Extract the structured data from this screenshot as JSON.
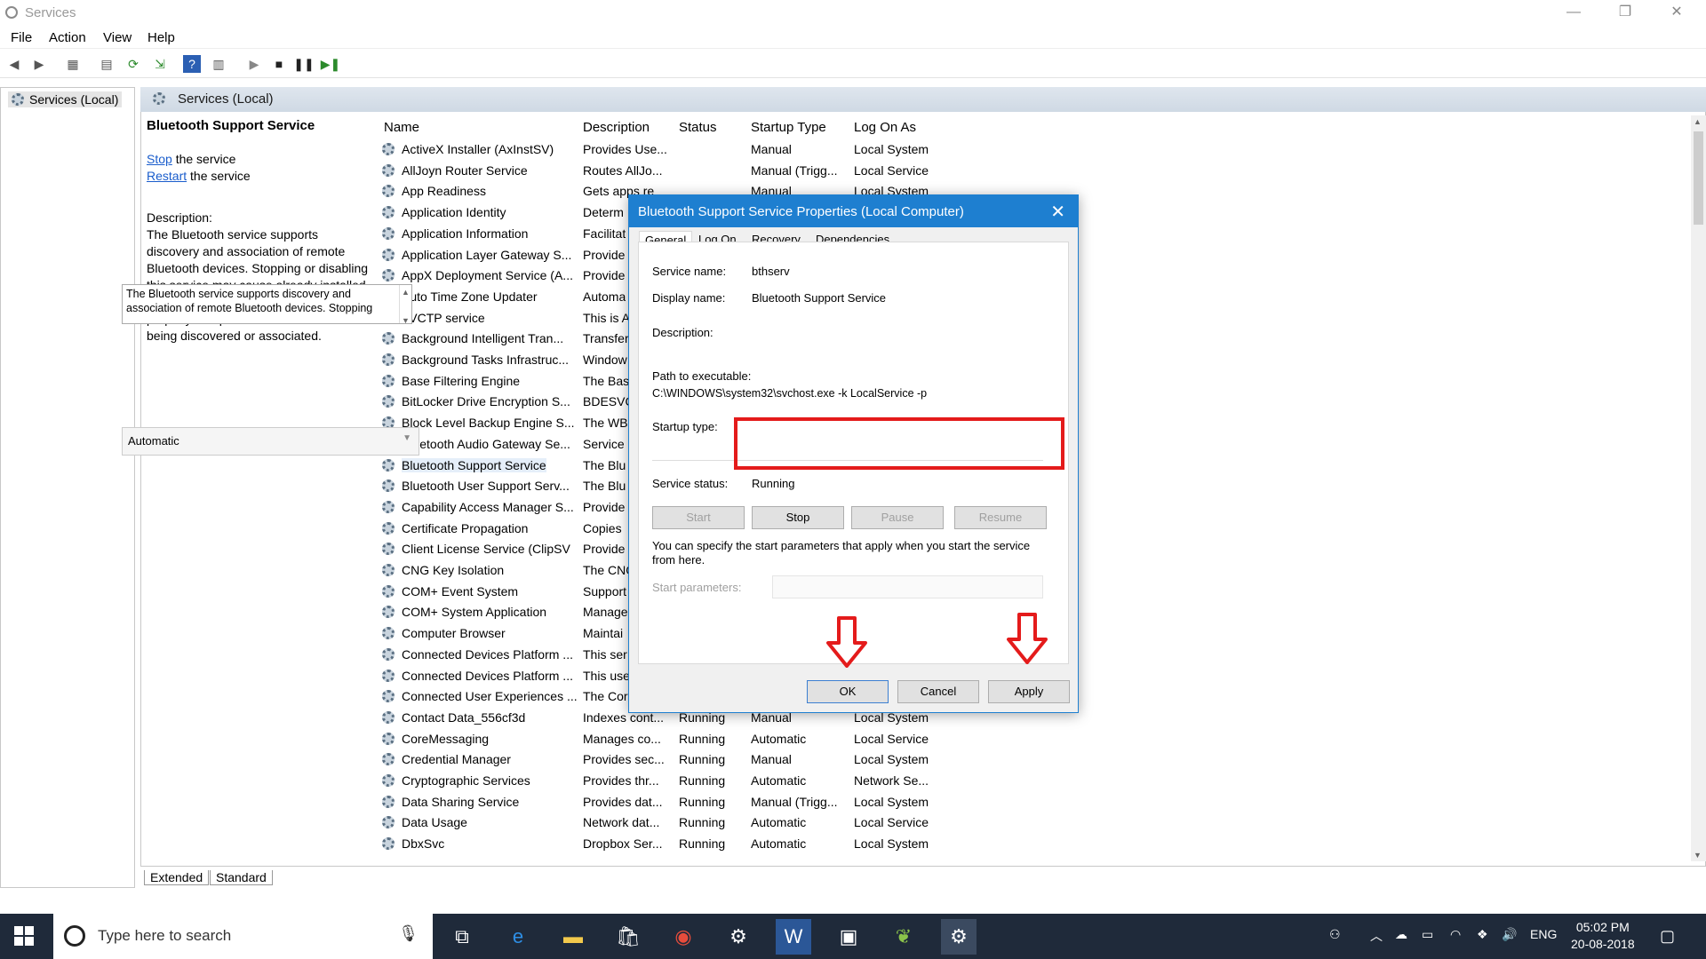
{
  "window": {
    "title": "Services",
    "minimize": "—",
    "maximize": "❐",
    "close": "✕"
  },
  "menu": [
    "File",
    "Action",
    "View",
    "Help"
  ],
  "tree": {
    "root": "Services (Local)"
  },
  "header": {
    "title": "Services (Local)"
  },
  "details": {
    "service_name": "Bluetooth Support Service",
    "stop_link": "Stop",
    "stop_suffix": " the service",
    "restart_link": "Restart",
    "restart_suffix": " the service",
    "description_label": "Description:",
    "description": "The Bluetooth service supports discovery and association of remote Bluetooth devices.  Stopping or disabling this service may cause already installed Bluetooth devices to fail to operate properly and prevent new devices from being discovered or associated."
  },
  "columns": [
    "Name",
    "Description",
    "Status",
    "Startup Type",
    "Log On As"
  ],
  "services": [
    {
      "name": "ActiveX Installer (AxInstSV)",
      "desc": "Provides Use...",
      "status": "",
      "startup": "Manual",
      "logon": "Local System"
    },
    {
      "name": "AllJoyn Router Service",
      "desc": "Routes AllJo...",
      "status": "",
      "startup": "Manual (Trigg...",
      "logon": "Local Service"
    },
    {
      "name": "App Readiness",
      "desc": "Gets apps re",
      "status": "",
      "startup": "Manual",
      "logon": "Local System"
    },
    {
      "name": "Application Identity",
      "desc": "Determ",
      "status": "",
      "startup": "",
      "logon": ""
    },
    {
      "name": "Application Information",
      "desc": "Facilitat",
      "status": "",
      "startup": "",
      "logon": ""
    },
    {
      "name": "Application Layer Gateway S...",
      "desc": "Provide",
      "status": "",
      "startup": "",
      "logon": ""
    },
    {
      "name": "AppX Deployment Service (A...",
      "desc": "Provide",
      "status": "",
      "startup": "",
      "logon": ""
    },
    {
      "name": "Auto Time Zone Updater",
      "desc": "Automa",
      "status": "",
      "startup": "",
      "logon": ""
    },
    {
      "name": "AVCTP service",
      "desc": "This is A",
      "status": "",
      "startup": "",
      "logon": ""
    },
    {
      "name": "Background Intelligent Tran...",
      "desc": "Transfer",
      "status": "",
      "startup": "",
      "logon": ""
    },
    {
      "name": "Background Tasks Infrastruc...",
      "desc": "Window",
      "status": "",
      "startup": "",
      "logon": ""
    },
    {
      "name": "Base Filtering Engine",
      "desc": "The Bas",
      "status": "",
      "startup": "",
      "logon": ""
    },
    {
      "name": "BitLocker Drive Encryption S...",
      "desc": "BDESVC",
      "status": "",
      "startup": "",
      "logon": ""
    },
    {
      "name": "Block Level Backup Engine S...",
      "desc": "The WB",
      "status": "",
      "startup": "",
      "logon": ""
    },
    {
      "name": "Bluetooth Audio Gateway Se...",
      "desc": "Service",
      "status": "",
      "startup": "",
      "logon": ""
    },
    {
      "name": "Bluetooth Support Service",
      "desc": "The Blu",
      "status": "",
      "startup": "",
      "logon": ""
    },
    {
      "name": "Bluetooth User Support Serv...",
      "desc": "The Blu",
      "status": "",
      "startup": "",
      "logon": ""
    },
    {
      "name": "Capability Access Manager S...",
      "desc": "Provide",
      "status": "",
      "startup": "",
      "logon": ""
    },
    {
      "name": "Certificate Propagation",
      "desc": "Copies",
      "status": "",
      "startup": "",
      "logon": ""
    },
    {
      "name": "Client License Service (ClipSV",
      "desc": "Provide",
      "status": "",
      "startup": "",
      "logon": ""
    },
    {
      "name": "CNG Key Isolation",
      "desc": "The CNG",
      "status": "",
      "startup": "",
      "logon": ""
    },
    {
      "name": "COM+ Event System",
      "desc": "Support",
      "status": "",
      "startup": "",
      "logon": ""
    },
    {
      "name": "COM+ System Application",
      "desc": "Manage",
      "status": "",
      "startup": "",
      "logon": ""
    },
    {
      "name": "Computer Browser",
      "desc": "Maintai",
      "status": "",
      "startup": "",
      "logon": ""
    },
    {
      "name": "Connected Devices Platform ...",
      "desc": "This ser",
      "status": "",
      "startup": "",
      "logon": ""
    },
    {
      "name": "Connected Devices Platform ...",
      "desc": "This use",
      "status": "",
      "startup": "",
      "logon": ""
    },
    {
      "name": "Connected User Experiences ...",
      "desc": "The Cor",
      "status": "",
      "startup": "",
      "logon": ""
    },
    {
      "name": "Contact Data_556cf3d",
      "desc": "Indexes cont...",
      "status": "Running",
      "startup": "Manual",
      "logon": "Local System"
    },
    {
      "name": "CoreMessaging",
      "desc": "Manages co...",
      "status": "Running",
      "startup": "Automatic",
      "logon": "Local Service"
    },
    {
      "name": "Credential Manager",
      "desc": "Provides sec...",
      "status": "Running",
      "startup": "Manual",
      "logon": "Local System"
    },
    {
      "name": "Cryptographic Services",
      "desc": "Provides thr...",
      "status": "Running",
      "startup": "Automatic",
      "logon": "Network Se..."
    },
    {
      "name": "Data Sharing Service",
      "desc": "Provides dat...",
      "status": "Running",
      "startup": "Manual (Trigg...",
      "logon": "Local System"
    },
    {
      "name": "Data Usage",
      "desc": "Network dat...",
      "status": "Running",
      "startup": "Automatic",
      "logon": "Local Service"
    },
    {
      "name": "DbxSvc",
      "desc": "Dropbox Ser...",
      "status": "Running",
      "startup": "Automatic",
      "logon": "Local System"
    }
  ],
  "bottom_tabs": [
    "Extended",
    "Standard"
  ],
  "dialog": {
    "title": "Bluetooth Support Service Properties (Local Computer)",
    "tabs": [
      "General",
      "Log On",
      "Recovery",
      "Dependencies"
    ],
    "service_name_label": "Service name:",
    "service_name": "bthserv",
    "display_name_label": "Display name:",
    "display_name": "Bluetooth Support Service",
    "description_label": "Description:",
    "description": "The Bluetooth service supports discovery and association of remote Bluetooth devices.  Stopping",
    "path_label": "Path to executable:",
    "path": "C:\\WINDOWS\\system32\\svchost.exe -k LocalService -p",
    "startup_label": "Startup type:",
    "startup_value": "Automatic",
    "status_label": "Service status:",
    "status_value": "Running",
    "btn_start": "Start",
    "btn_stop": "Stop",
    "btn_pause": "Pause",
    "btn_resume": "Resume",
    "hint": "You can specify the start parameters that apply when you start the service from here.",
    "start_params_label": "Start parameters:",
    "ok": "OK",
    "cancel": "Cancel",
    "apply": "Apply"
  },
  "taskbar": {
    "search_placeholder": "Type here to search",
    "lang": "ENG",
    "time": "05:02 PM",
    "date": "20-08-2018"
  },
  "colors": {
    "accent": "#1e7fd0",
    "highlight_red": "#e41b1b",
    "taskbar": "#1f2a3a"
  }
}
